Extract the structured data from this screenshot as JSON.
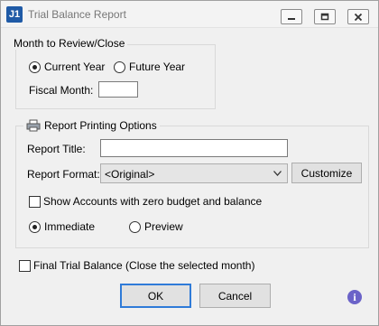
{
  "window": {
    "title": "Trial Balance Report",
    "logo_text": "J1",
    "icons": {
      "minimize": "minimize-icon",
      "maximize": "maximize-icon",
      "close": "close-icon"
    }
  },
  "month_group": {
    "legend": "Month to Review/Close",
    "radio_current": "Current Year",
    "radio_future": "Future Year",
    "selected": "Current Year",
    "fiscal_month_label": "Fiscal Month:",
    "fiscal_month_value": ""
  },
  "report_group": {
    "legend": "Report Printing Options",
    "legend_icon": "printer-icon",
    "title_label": "Report Title:",
    "title_value": "",
    "format_label": "Report Format:",
    "format_value": "<Original>",
    "customize_label": "Customize",
    "show_accounts_label": "Show Accounts with zero budget and balance",
    "show_accounts_checked": false,
    "radio_immediate": "Immediate",
    "radio_preview": "Preview",
    "selected_output": "Immediate"
  },
  "final_trial_balance_label": "Final Trial Balance (Close the selected month)",
  "final_trial_balance_checked": false,
  "buttons": {
    "ok": "OK",
    "cancel": "Cancel"
  },
  "help_icon_glyph": "i"
}
